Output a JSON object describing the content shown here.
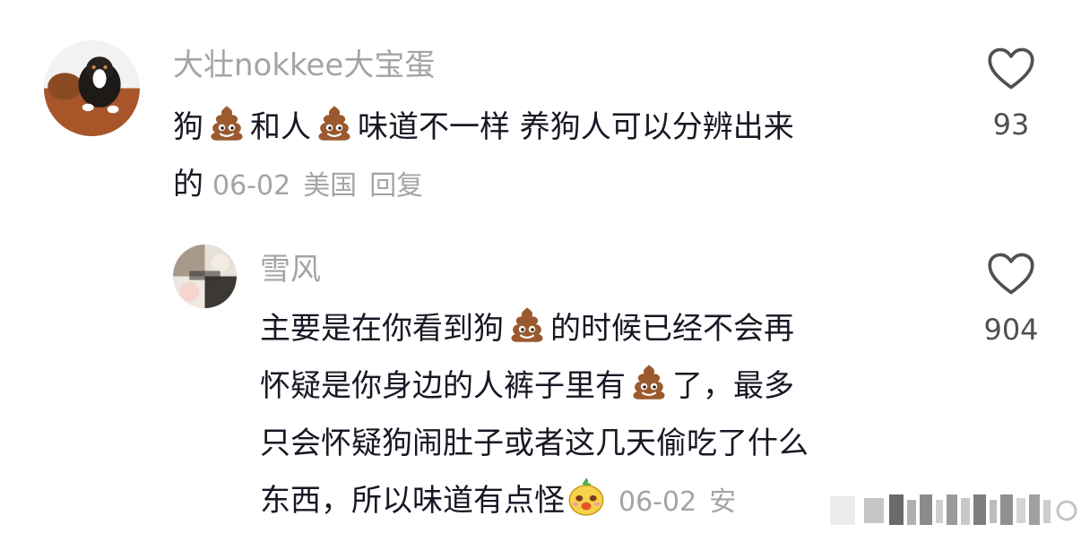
{
  "comments": [
    {
      "username": "大壮nokkee大宝蛋",
      "line1_a": "狗",
      "line1_b": "和人",
      "line1_c": "味道不一样 养狗人可以分辨出来",
      "line2_a": "的",
      "date": "06-02",
      "location": "美国",
      "reply_label": "回复",
      "like_count": "93"
    },
    {
      "username": "雪风",
      "line1_a": "主要是在你看到狗",
      "line1_b": "的时候已经不会再",
      "line2_a": "怀疑是你身边的人裤子里有",
      "line2_b": "了，最多",
      "line3": "只会怀疑狗闹肚子或者这几天偷吃了什么",
      "line4_a": "东西，所以味道有点怪",
      "date": "06-02",
      "location_partial": "安",
      "like_count": "904"
    }
  ],
  "icons": {
    "emoji": "poop-emoji",
    "sticker": "bean-face-sticker",
    "like": "heart-outline-icon"
  },
  "colors": {
    "username": "#a4a4a4",
    "text": "#161823",
    "meta": "#a4a4a4",
    "like_count": "#505050"
  }
}
